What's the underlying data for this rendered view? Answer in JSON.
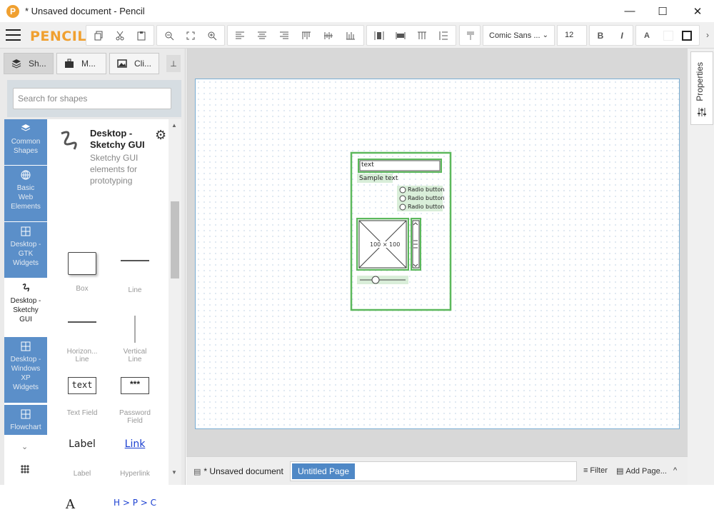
{
  "window": {
    "title": "* Unsaved document - Pencil",
    "logo_letter": "P",
    "minimize": "—",
    "maximize": "☐",
    "close": "✕"
  },
  "toolbar": {
    "brand": "PENCIL",
    "font": "Comic Sans ...",
    "font_dropdown": "⌄",
    "font_size": "12",
    "bold": "B",
    "italic": "I",
    "font_color": "A"
  },
  "left_tabs": [
    {
      "label": "Sh...",
      "icon": "layers-icon"
    },
    {
      "label": "M...",
      "icon": "briefcase-icon"
    },
    {
      "label": "Cli...",
      "icon": "image-icon"
    }
  ],
  "pin": "📌",
  "search": {
    "placeholder": "Search for shapes"
  },
  "collections": [
    {
      "label": "Common\nShapes"
    },
    {
      "label": "Basic\nWeb\nElements"
    },
    {
      "label": "Desktop -\nGTK\nWidgets"
    },
    {
      "label": "Desktop -\nSketchy\nGUI"
    },
    {
      "label": "Desktop -\nWindows\nXP\nWidgets"
    },
    {
      "label": "Flowchart"
    }
  ],
  "collection_header": {
    "title": "Desktop -\nSketchy GUI",
    "description": "Sketchy GUI\nelements for\nprototyping"
  },
  "shapes": [
    {
      "label": "Box"
    },
    {
      "label": "Line"
    },
    {
      "label": "Horizon...\nLine"
    },
    {
      "label": "Vertical\nLine"
    },
    {
      "label": "Text Field",
      "preview": "text"
    },
    {
      "label": "Password\nField",
      "preview": "***"
    },
    {
      "label": "Label",
      "preview": "Label"
    },
    {
      "label": "Hyperlink",
      "preview": "Link"
    },
    {
      "label": "",
      "preview": "A"
    },
    {
      "label": "",
      "preview": "H > P > C"
    }
  ],
  "canvas": {
    "textfield": "text",
    "label": "Sample text",
    "radios": [
      "Radio button",
      "Radio button",
      "Radio button"
    ],
    "image": "100 × 100"
  },
  "properties_label": "Properties",
  "bottom": {
    "document": "* Unsaved document",
    "page": "Untitled Page",
    "filter": "Filter",
    "add_page": "Add Page...",
    "expand": "^"
  },
  "colors": {
    "accent": "#f0a030",
    "collection_bg": "#5b8fc9",
    "page_chip": "#4f88c6",
    "sketch_green": "#5cb85c"
  }
}
